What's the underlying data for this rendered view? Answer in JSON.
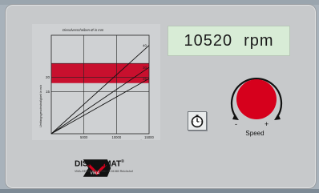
{
  "display": {
    "rpm_value": "10520",
    "rpm_unit": "rpm"
  },
  "chart": {
    "title": "Dissolverscheiben-Ø in mm",
    "ylabel": "Umfangsgeschwindigkeit in m/s",
    "xlabel": "Drehzahl in min⁻¹",
    "y_ticks": [
      "20",
      "15"
    ],
    "x_ticks": [
      "5000",
      "10000",
      "15000"
    ],
    "line_labels": [
      "40",
      "30",
      "25"
    ],
    "band_color": "#c8102e"
  },
  "chart_data": {
    "type": "line",
    "title": "Dissolverscheiben-Ø in mm",
    "xlabel": "Drehzahl in min⁻¹",
    "ylabel": "Umfangsgeschwindigkeit in m/s",
    "xlim": [
      0,
      15000
    ],
    "ylim": [
      0,
      35
    ],
    "grid": true,
    "series": [
      {
        "name": "40",
        "x": [
          0,
          15000
        ],
        "y": [
          0,
          31.4
        ]
      },
      {
        "name": "30",
        "x": [
          0,
          15000
        ],
        "y": [
          0,
          23.6
        ]
      },
      {
        "name": "25",
        "x": [
          0,
          15000
        ],
        "y": [
          0,
          19.6
        ]
      }
    ],
    "highlight_band": {
      "y": [
        18,
        25
      ],
      "color": "#c8102e"
    }
  },
  "controls": {
    "speed_label": "Speed",
    "minus": "-",
    "plus": "+",
    "knob_color": "#d6001c"
  },
  "brand": {
    "logo_text": "VMA",
    "name": "DISPERMAT",
    "registered": "®",
    "sub": "VMA-GETZMANN GMBH D-51580 Reichshof"
  }
}
